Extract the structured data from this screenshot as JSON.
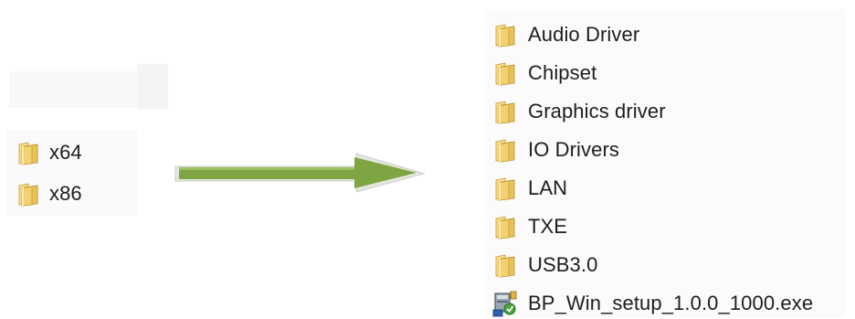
{
  "left_folder_list": {
    "items": [
      {
        "label": "x64",
        "icon": "folder-icon"
      },
      {
        "label": "x86",
        "icon": "folder-icon"
      }
    ]
  },
  "arrow": {
    "icon": "right-arrow-icon",
    "color": "#7ea542"
  },
  "right_folder_list": {
    "items": [
      {
        "label": "Audio Driver",
        "icon": "folder-icon"
      },
      {
        "label": "Chipset",
        "icon": "folder-icon"
      },
      {
        "label": "Graphics driver",
        "icon": "folder-icon"
      },
      {
        "label": "IO Drivers",
        "icon": "folder-icon"
      },
      {
        "label": "LAN",
        "icon": "folder-icon"
      },
      {
        "label": "TXE",
        "icon": "folder-icon"
      },
      {
        "label": "USB3.0",
        "icon": "folder-icon"
      },
      {
        "label": "BP_Win_setup_1.0.0_1000.exe",
        "icon": "installer-exe-icon"
      }
    ]
  },
  "colors": {
    "folder_body": "#e8c35a",
    "folder_tab": "#f4dc8e",
    "text": "#1e1e1e"
  }
}
